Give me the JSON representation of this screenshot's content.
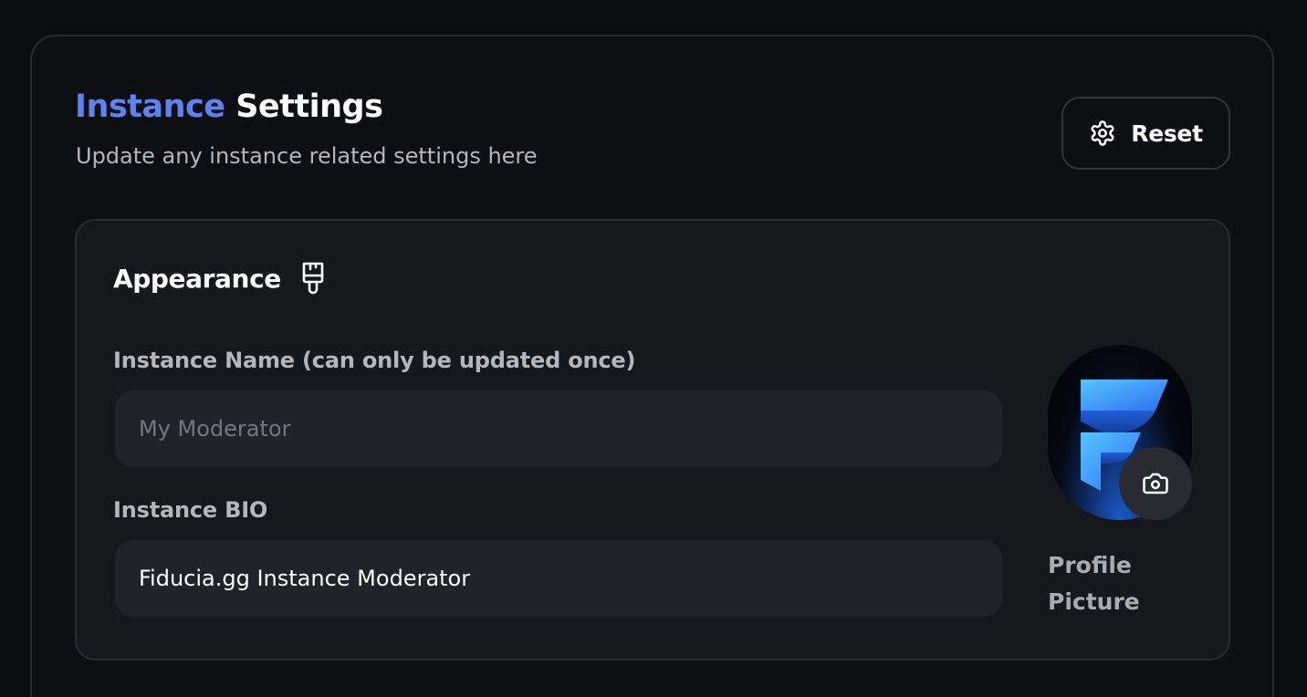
{
  "header": {
    "title_accent": "Instance",
    "title_rest": "Settings",
    "subtitle": "Update any instance related settings here",
    "reset_label": "Reset",
    "reset_icon": "gear-icon"
  },
  "appearance": {
    "title": "Appearance",
    "icon": "paintbrush-icon",
    "instance_name": {
      "label": "Instance Name (can only be updated once)",
      "value": "",
      "placeholder": "My Moderator"
    },
    "instance_bio": {
      "label": "Instance BIO",
      "value": "Fiducia.gg Instance Moderator",
      "placeholder": ""
    },
    "profile_picture": {
      "caption": "Profile Picture",
      "camera_icon": "camera-icon"
    }
  },
  "colors": {
    "accent": "#5b84f2",
    "background": "#0b0c10",
    "card": "#17181c",
    "input": "#222328"
  }
}
